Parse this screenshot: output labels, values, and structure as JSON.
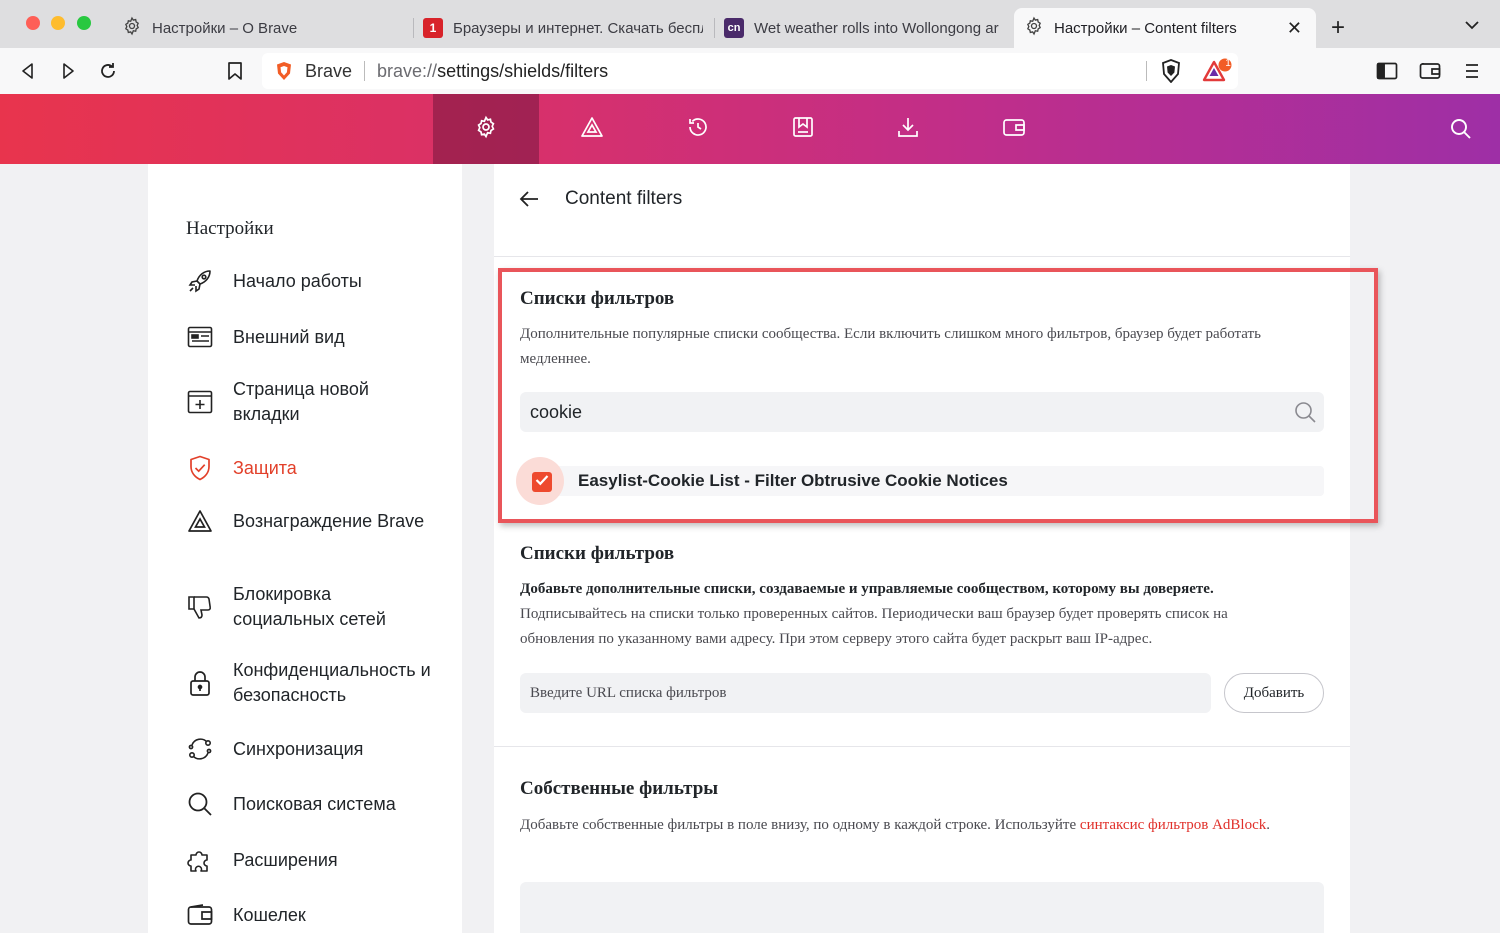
{
  "tabs": [
    {
      "title": "Настройки – О Brave",
      "icon": "gear-icon"
    },
    {
      "title": "Браузеры и интернет. Скачать бесплатно",
      "icon": "site-favicon-1",
      "favicon_color": "#d8232a",
      "favicon_text": "1"
    },
    {
      "title": "Wet weather rolls into Wollongong area",
      "icon": "site-favicon-cn",
      "favicon_color": "#4a2a6a",
      "favicon_text": "cn"
    },
    {
      "title": "Настройки – Content filters",
      "icon": "gear-icon",
      "active": true
    }
  ],
  "toolbar": {
    "site_name": "Brave",
    "url_prefix": "brave://",
    "url_path": "settings/shields/filters",
    "rewards_badge": "1"
  },
  "header": {
    "buttons": [
      "gear-icon",
      "rewards-icon",
      "history-icon",
      "bookmarks-icon",
      "downloads-icon",
      "wallet-icon"
    ],
    "search_icon": "search-icon"
  },
  "sidebar": {
    "title": "Настройки",
    "items": [
      {
        "label": "Начало работы",
        "icon": "rocket-icon"
      },
      {
        "label": "Внешний вид",
        "icon": "appearance-icon"
      },
      {
        "label": "Страница новой вкладки",
        "icon": "new-tab-icon"
      },
      {
        "label": "Защита",
        "icon": "shield-icon",
        "active": true
      },
      {
        "label": "Вознаграждение Brave",
        "icon": "rewards-icon"
      },
      {
        "label": "Блокировка социальных сетей",
        "icon": "thumbs-down-icon"
      },
      {
        "label": "Конфиденциальность и безопасность",
        "icon": "lock-icon"
      },
      {
        "label": "Синхронизация",
        "icon": "sync-icon"
      },
      {
        "label": "Поисковая система",
        "icon": "search-icon"
      },
      {
        "label": "Расширения",
        "icon": "puzzle-icon"
      },
      {
        "label": "Кошелек",
        "icon": "wallet-icon"
      }
    ]
  },
  "main": {
    "title": "Content filters",
    "filter_lists": {
      "heading": "Списки фильтров",
      "description": "Дополнительные популярные списки сообщества. Если включить слишком много фильтров, браузер будет работать медленнее.",
      "search_value": "cookie",
      "result_label": "Easylist-Cookie List - Filter Obtrusive Cookie Notices",
      "result_checked": true
    },
    "custom_lists": {
      "heading": "Списки фильтров",
      "description_bold": "Добавьте дополнительные списки, создаваемые и управляемые сообществом, которому вы доверяете.",
      "description": "Подписывайтесь на списки только проверенных сайтов. Периодически ваш браузер будет проверять список на обновления по указанному вами адресу. При этом серверу этого сайта будет раскрыт ваш IP-адрес.",
      "url_placeholder": "Введите URL списка фильтров",
      "add_button": "Добавить"
    },
    "own_filters": {
      "heading": "Собственные фильтры",
      "description": "Добавьте собственные фильтры в поле внизу, по одному в каждой строке. Используйте ",
      "link_text": "синтаксис фильтров AdBlock",
      "description_end": "."
    }
  },
  "colors": {
    "accent": "#e2402a",
    "highlight_frame": "#e9555a",
    "header_gradient_start": "#e8344d",
    "header_gradient_end": "#9e2fa6"
  }
}
